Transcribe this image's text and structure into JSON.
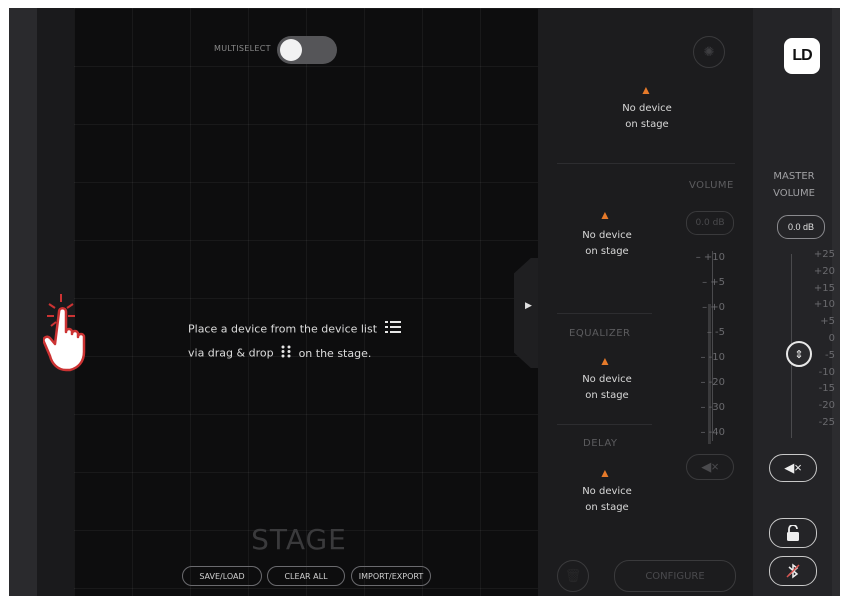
{
  "stage": {
    "multiselect_label": "MULTISELECT",
    "multiselect_on": false,
    "instruction_line1": "Place a device from the device list",
    "instruction_line2_a": "via drag & drop",
    "instruction_line2_b": "on the stage.",
    "title": "STAGE",
    "buttons": {
      "save_load": "SAVE/LOAD",
      "clear_all": "CLEAR ALL",
      "import_export": "IMPORT/EXPORT"
    }
  },
  "device_panel": {
    "warning_glyph": "▲",
    "top_device": {
      "line1": "No device",
      "line2": "on stage"
    },
    "volume": {
      "label": "VOLUME",
      "device": {
        "line1": "No device",
        "line2": "on stage"
      },
      "db_value": "0.0 dB",
      "scale": [
        "+10",
        "+5",
        "+0",
        "-5",
        "-10",
        "-20",
        "-30",
        "-40"
      ]
    },
    "equalizer": {
      "label": "EQUALIZER",
      "device": {
        "line1": "No device",
        "line2": "on stage"
      }
    },
    "delay": {
      "label": "DELAY",
      "device": {
        "line1": "No device",
        "line2": "on stage"
      }
    },
    "mute_glyph": "◀×",
    "trash_glyph": "🗑",
    "configure_label": "CONFIGURE"
  },
  "master": {
    "logo": "LD",
    "label_line1": "MASTER",
    "label_line2": "VOLUME",
    "db_value": "0.0 dB",
    "scale": [
      "+25",
      "+20",
      "+15",
      "+10",
      "+5",
      "0",
      "-5",
      "-10",
      "-15",
      "-20",
      "-25"
    ],
    "fader_glyph": "⇕",
    "mute_glyph": "◀×",
    "lock_glyph": "🔓",
    "bluetooth_glyph": "✱"
  },
  "colors": {
    "warning": "#e67a2a",
    "background": "#111113",
    "accent_text": "#e0e0e0"
  }
}
